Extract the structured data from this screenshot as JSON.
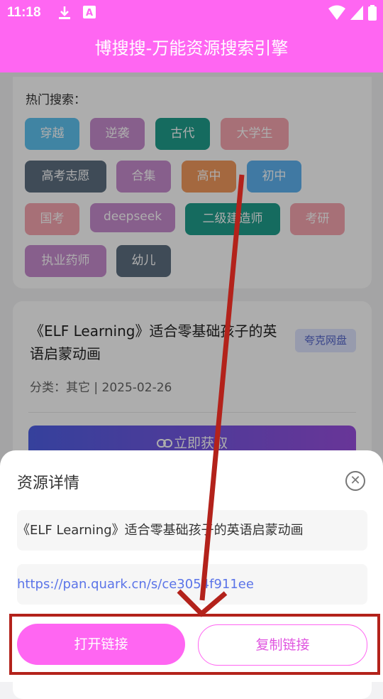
{
  "status_bar": {
    "time": "11:18",
    "icons": [
      "download-icon",
      "font-app-icon",
      "wifi-icon",
      "signal-icon",
      "battery-icon"
    ]
  },
  "app_bar": {
    "title": "博搜搜-万能资源搜索引擎"
  },
  "hot_search": {
    "title": "热门搜索：",
    "tags": [
      {
        "label": "穿越",
        "color": "#5fc3f0"
      },
      {
        "label": "逆袭",
        "color": "#c88ccf"
      },
      {
        "label": "古代",
        "color": "#1f9e8c"
      },
      {
        "label": "大学生",
        "color": "#f7a6b0"
      },
      {
        "label": "高考志愿",
        "color": "#5e6f80"
      },
      {
        "label": "合集",
        "color": "#c88ccf"
      },
      {
        "label": "高中",
        "color": "#f29a5e"
      },
      {
        "label": "初中",
        "color": "#5fb3f0"
      },
      {
        "label": "国考",
        "color": "#f7a6b0"
      },
      {
        "label": "deepseek",
        "color": "#c88ccf"
      },
      {
        "label": "二级建造师",
        "color": "#1f9e8c"
      },
      {
        "label": "考研",
        "color": "#f7a6b0"
      },
      {
        "label": "执业药师",
        "color": "#c88ccf"
      },
      {
        "label": "幼儿",
        "color": "#5e6f80"
      }
    ]
  },
  "resource_card": {
    "title": "《ELF Learning》适合零基础孩子的英语启蒙动画",
    "badge": "夸克网盘",
    "meta": "分类：其它 | 2025-02-26",
    "button_label": "立即获取"
  },
  "sheet": {
    "title": "资源详情",
    "resource_name": "《ELF Learning》适合零基础孩子的英语启蒙动画",
    "link": "https://pan.quark.cn/s/ce3054f911ee",
    "open_label": "打开链接",
    "copy_label": "复制链接"
  },
  "colors": {
    "accent": "#ff66f2",
    "annotation": "#b3221b",
    "link": "#5b74e8"
  }
}
